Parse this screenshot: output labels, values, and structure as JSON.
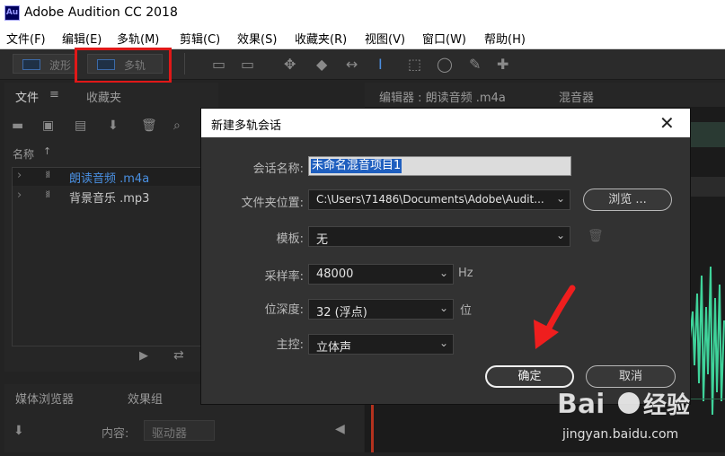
{
  "app": {
    "logo_text": "Au",
    "title": "Adobe Audition CC 2018"
  },
  "menu": [
    "文件(F)",
    "编辑(E)",
    "多轨(M)",
    "剪辑(C)",
    "效果(S)",
    "收藏夹(R)",
    "视图(V)",
    "窗口(W)",
    "帮助(H)"
  ],
  "toolbar": {
    "waveform_label": "波形",
    "multitrack_label": "多轨"
  },
  "files_panel": {
    "tab_files": "文件",
    "tab_favorites": "收藏夹",
    "column_name": "名称",
    "items": [
      {
        "name": "朗读音频 .m4a",
        "color": "#4a90e2"
      },
      {
        "name": "背景音乐 .mp3",
        "color": "#c8c8c8"
      }
    ]
  },
  "editor_panel": {
    "tab_editor": "编辑器 : 朗读音频 .m4a",
    "tab_mixer": "混音器"
  },
  "media_panel": {
    "tab_media": "媒体浏览器",
    "tab_effects": "效果组",
    "content_label": "内容:",
    "content_value": "驱动器"
  },
  "dialog": {
    "title": "新建多轨会话",
    "session_name_label": "会话名称:",
    "session_name_value": "未命名混音项目1",
    "folder_label": "文件夹位置:",
    "folder_value": "C:\\Users\\71486\\Documents\\Adobe\\Audit...",
    "browse_label": "浏览 ...",
    "template_label": "模板:",
    "template_value": "无",
    "sample_rate_label": "采样率:",
    "sample_rate_value": "48000",
    "sample_rate_unit": "Hz",
    "bit_depth_label": "位深度:",
    "bit_depth_value": "32 (浮点)",
    "bit_depth_unit": "位",
    "master_label": "主控:",
    "master_value": "立体声",
    "ok_label": "确定",
    "cancel_label": "取消"
  },
  "watermark": {
    "logo": "Baidu经验",
    "url": "jingyan.baidu.com"
  },
  "colors": {
    "highlight": "#e01818",
    "selection": "#1f5fbf",
    "waveform": "#3fd39a"
  }
}
